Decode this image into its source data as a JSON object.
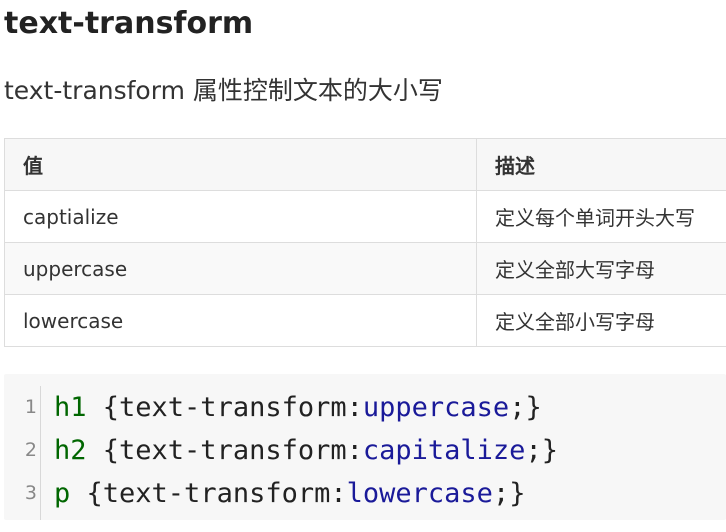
{
  "heading": "text-transform",
  "description": "text-transform 属性控制文本的大小写",
  "table": {
    "headers": [
      "值",
      "描述"
    ],
    "rows": [
      [
        "captialize",
        "定义每个单词开头大写"
      ],
      [
        "uppercase",
        "定义全部大写字母"
      ],
      [
        "lowercase",
        "定义全部小写字母"
      ]
    ]
  },
  "code": {
    "line_numbers": [
      "1",
      "2",
      "3"
    ],
    "lines": [
      {
        "selector": "h1",
        "open": " {",
        "property": "text-transform:",
        "value": "uppercase",
        "close": ";}"
      },
      {
        "selector": "h2",
        "open": " {",
        "property": "text-transform:",
        "value": "capitalize",
        "close": ";}"
      },
      {
        "selector": "p",
        "open": " {",
        "property": "text-transform:",
        "value": "lowercase",
        "close": ";}"
      }
    ]
  },
  "colors": {
    "selector": "#006600",
    "value": "#1a1a99",
    "code_background": "#f7f7f7"
  }
}
